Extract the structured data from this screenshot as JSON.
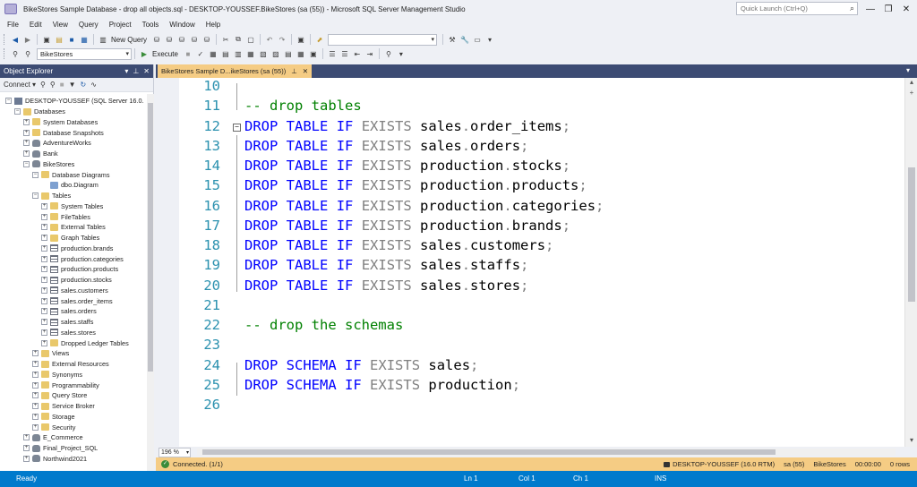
{
  "window": {
    "title": "BikeStores Sample Database - drop all objects.sql - DESKTOP-YOUSSEF.BikeStores (sa (55)) - Microsoft SQL Server Management Studio",
    "quick_launch_placeholder": "Quick Launch (Ctrl+Q)"
  },
  "menu": [
    "File",
    "Edit",
    "View",
    "Query",
    "Project",
    "Tools",
    "Window",
    "Help"
  ],
  "toolbar": {
    "new_query_label": "New Query",
    "database_selector": "BikeStores",
    "execute_label": "Execute"
  },
  "object_explorer": {
    "title": "Object Explorer",
    "connect_label": "Connect",
    "tree": [
      {
        "label": "DESKTOP-YOUSSEF (SQL Server 16.0.",
        "level": 0,
        "icon": "server-icon",
        "toggle": "-"
      },
      {
        "label": "Databases",
        "level": 1,
        "icon": "folder-icon",
        "toggle": "-"
      },
      {
        "label": "System Databases",
        "level": 2,
        "icon": "folder-icon",
        "toggle": "+"
      },
      {
        "label": "Database Snapshots",
        "level": 2,
        "icon": "folder-icon",
        "toggle": "+"
      },
      {
        "label": "AdventureWorks",
        "level": 2,
        "icon": "database-icon",
        "toggle": "+"
      },
      {
        "label": "Bank",
        "level": 2,
        "icon": "database-icon",
        "toggle": "+"
      },
      {
        "label": "BikeStores",
        "level": 2,
        "icon": "database-icon",
        "toggle": "-"
      },
      {
        "label": "Database Diagrams",
        "level": 3,
        "icon": "folder-icon",
        "toggle": "-"
      },
      {
        "label": "dbo.Diagram",
        "level": 4,
        "icon": "diagram-icon",
        "toggle": ""
      },
      {
        "label": "Tables",
        "level": 3,
        "icon": "folder-icon",
        "toggle": "-"
      },
      {
        "label": "System Tables",
        "level": 4,
        "icon": "folder-icon",
        "toggle": "+"
      },
      {
        "label": "FileTables",
        "level": 4,
        "icon": "folder-icon",
        "toggle": "+"
      },
      {
        "label": "External Tables",
        "level": 4,
        "icon": "folder-icon",
        "toggle": "+"
      },
      {
        "label": "Graph Tables",
        "level": 4,
        "icon": "folder-icon",
        "toggle": "+"
      },
      {
        "label": "production.brands",
        "level": 4,
        "icon": "table-icon",
        "toggle": "+"
      },
      {
        "label": "production.categories",
        "level": 4,
        "icon": "table-icon",
        "toggle": "+"
      },
      {
        "label": "production.products",
        "level": 4,
        "icon": "table-icon",
        "toggle": "+"
      },
      {
        "label": "production.stocks",
        "level": 4,
        "icon": "table-icon",
        "toggle": "+"
      },
      {
        "label": "sales.customers",
        "level": 4,
        "icon": "table-icon",
        "toggle": "+"
      },
      {
        "label": "sales.order_items",
        "level": 4,
        "icon": "table-icon",
        "toggle": "+"
      },
      {
        "label": "sales.orders",
        "level": 4,
        "icon": "table-icon",
        "toggle": "+"
      },
      {
        "label": "sales.staffs",
        "level": 4,
        "icon": "table-icon",
        "toggle": "+"
      },
      {
        "label": "sales.stores",
        "level": 4,
        "icon": "table-icon",
        "toggle": "+"
      },
      {
        "label": "Dropped Ledger Tables",
        "level": 4,
        "icon": "folder-icon",
        "toggle": "+"
      },
      {
        "label": "Views",
        "level": 3,
        "icon": "folder-icon",
        "toggle": "+"
      },
      {
        "label": "External Resources",
        "level": 3,
        "icon": "folder-icon",
        "toggle": "+"
      },
      {
        "label": "Synonyms",
        "level": 3,
        "icon": "folder-icon",
        "toggle": "+"
      },
      {
        "label": "Programmability",
        "level": 3,
        "icon": "folder-icon",
        "toggle": "+"
      },
      {
        "label": "Query Store",
        "level": 3,
        "icon": "folder-icon",
        "toggle": "+"
      },
      {
        "label": "Service Broker",
        "level": 3,
        "icon": "folder-icon",
        "toggle": "+"
      },
      {
        "label": "Storage",
        "level": 3,
        "icon": "folder-icon",
        "toggle": "+"
      },
      {
        "label": "Security",
        "level": 3,
        "icon": "folder-icon",
        "toggle": "+"
      },
      {
        "label": "E_Commerce",
        "level": 2,
        "icon": "database-icon",
        "toggle": "+"
      },
      {
        "label": "Final_Project_SQL",
        "level": 2,
        "icon": "database-icon",
        "toggle": "+"
      },
      {
        "label": "Northwind2021",
        "level": 2,
        "icon": "database-icon",
        "toggle": "+"
      }
    ]
  },
  "editor": {
    "tab_title": "BikeStores Sample D...ikeStores (sa (55))",
    "lines": [
      {
        "no": "10",
        "tokens": []
      },
      {
        "no": "11",
        "tokens": [
          {
            "t": "-- drop tables",
            "c": "cm"
          }
        ]
      },
      {
        "no": "12",
        "fold": "-",
        "tokens": [
          {
            "t": "DROP",
            "c": "kw"
          },
          {
            "t": " "
          },
          {
            "t": "TABLE",
            "c": "kw"
          },
          {
            "t": " "
          },
          {
            "t": "IF",
            "c": "kw"
          },
          {
            "t": " "
          },
          {
            "t": "EXISTS",
            "c": "gray"
          },
          {
            "t": " sales"
          },
          {
            "t": ".",
            "c": "gray"
          },
          {
            "t": "order_items"
          },
          {
            "t": ";",
            "c": "gray"
          }
        ]
      },
      {
        "no": "13",
        "tokens": [
          {
            "t": "DROP",
            "c": "kw"
          },
          {
            "t": " "
          },
          {
            "t": "TABLE",
            "c": "kw"
          },
          {
            "t": " "
          },
          {
            "t": "IF",
            "c": "kw"
          },
          {
            "t": " "
          },
          {
            "t": "EXISTS",
            "c": "gray"
          },
          {
            "t": " sales"
          },
          {
            "t": ".",
            "c": "gray"
          },
          {
            "t": "orders"
          },
          {
            "t": ";",
            "c": "gray"
          }
        ]
      },
      {
        "no": "14",
        "tokens": [
          {
            "t": "DROP",
            "c": "kw"
          },
          {
            "t": " "
          },
          {
            "t": "TABLE",
            "c": "kw"
          },
          {
            "t": " "
          },
          {
            "t": "IF",
            "c": "kw"
          },
          {
            "t": " "
          },
          {
            "t": "EXISTS",
            "c": "gray"
          },
          {
            "t": " production"
          },
          {
            "t": ".",
            "c": "gray"
          },
          {
            "t": "stocks"
          },
          {
            "t": ";",
            "c": "gray"
          }
        ]
      },
      {
        "no": "15",
        "tokens": [
          {
            "t": "DROP",
            "c": "kw"
          },
          {
            "t": " "
          },
          {
            "t": "TABLE",
            "c": "kw"
          },
          {
            "t": " "
          },
          {
            "t": "IF",
            "c": "kw"
          },
          {
            "t": " "
          },
          {
            "t": "EXISTS",
            "c": "gray"
          },
          {
            "t": " production"
          },
          {
            "t": ".",
            "c": "gray"
          },
          {
            "t": "products"
          },
          {
            "t": ";",
            "c": "gray"
          }
        ]
      },
      {
        "no": "16",
        "tokens": [
          {
            "t": "DROP",
            "c": "kw"
          },
          {
            "t": " "
          },
          {
            "t": "TABLE",
            "c": "kw"
          },
          {
            "t": " "
          },
          {
            "t": "IF",
            "c": "kw"
          },
          {
            "t": " "
          },
          {
            "t": "EXISTS",
            "c": "gray"
          },
          {
            "t": " production"
          },
          {
            "t": ".",
            "c": "gray"
          },
          {
            "t": "categories"
          },
          {
            "t": ";",
            "c": "gray"
          }
        ]
      },
      {
        "no": "17",
        "tokens": [
          {
            "t": "DROP",
            "c": "kw"
          },
          {
            "t": " "
          },
          {
            "t": "TABLE",
            "c": "kw"
          },
          {
            "t": " "
          },
          {
            "t": "IF",
            "c": "kw"
          },
          {
            "t": " "
          },
          {
            "t": "EXISTS",
            "c": "gray"
          },
          {
            "t": " production"
          },
          {
            "t": ".",
            "c": "gray"
          },
          {
            "t": "brands"
          },
          {
            "t": ";",
            "c": "gray"
          }
        ]
      },
      {
        "no": "18",
        "tokens": [
          {
            "t": "DROP",
            "c": "kw"
          },
          {
            "t": " "
          },
          {
            "t": "TABLE",
            "c": "kw"
          },
          {
            "t": " "
          },
          {
            "t": "IF",
            "c": "kw"
          },
          {
            "t": " "
          },
          {
            "t": "EXISTS",
            "c": "gray"
          },
          {
            "t": " sales"
          },
          {
            "t": ".",
            "c": "gray"
          },
          {
            "t": "customers"
          },
          {
            "t": ";",
            "c": "gray"
          }
        ]
      },
      {
        "no": "19",
        "tokens": [
          {
            "t": "DROP",
            "c": "kw"
          },
          {
            "t": " "
          },
          {
            "t": "TABLE",
            "c": "kw"
          },
          {
            "t": " "
          },
          {
            "t": "IF",
            "c": "kw"
          },
          {
            "t": " "
          },
          {
            "t": "EXISTS",
            "c": "gray"
          },
          {
            "t": " sales"
          },
          {
            "t": ".",
            "c": "gray"
          },
          {
            "t": "staffs"
          },
          {
            "t": ";",
            "c": "gray"
          }
        ]
      },
      {
        "no": "20",
        "tokens": [
          {
            "t": "DROP",
            "c": "kw"
          },
          {
            "t": " "
          },
          {
            "t": "TABLE",
            "c": "kw"
          },
          {
            "t": " "
          },
          {
            "t": "IF",
            "c": "kw"
          },
          {
            "t": " "
          },
          {
            "t": "EXISTS",
            "c": "gray"
          },
          {
            "t": " sales"
          },
          {
            "t": ".",
            "c": "gray"
          },
          {
            "t": "stores"
          },
          {
            "t": ";",
            "c": "gray"
          }
        ]
      },
      {
        "no": "21",
        "tokens": []
      },
      {
        "no": "22",
        "tokens": [
          {
            "t": "-- drop the schemas",
            "c": "cm"
          }
        ]
      },
      {
        "no": "23",
        "tokens": []
      },
      {
        "no": "24",
        "tokens": [
          {
            "t": "DROP",
            "c": "kw"
          },
          {
            "t": " "
          },
          {
            "t": "SCHEMA",
            "c": "kw"
          },
          {
            "t": " "
          },
          {
            "t": "IF",
            "c": "kw"
          },
          {
            "t": " "
          },
          {
            "t": "EXISTS",
            "c": "gray"
          },
          {
            "t": " sales"
          },
          {
            "t": ";",
            "c": "gray"
          }
        ]
      },
      {
        "no": "25",
        "tokens": [
          {
            "t": "DROP",
            "c": "kw"
          },
          {
            "t": " "
          },
          {
            "t": "SCHEMA",
            "c": "kw"
          },
          {
            "t": " "
          },
          {
            "t": "IF",
            "c": "kw"
          },
          {
            "t": " "
          },
          {
            "t": "EXISTS",
            "c": "gray"
          },
          {
            "t": " production"
          },
          {
            "t": ";",
            "c": "gray"
          }
        ]
      },
      {
        "no": "26",
        "tokens": []
      }
    ],
    "zoom": "196 %"
  },
  "connection_bar": {
    "status": "Connected. (1/1)",
    "server": "DESKTOP-YOUSSEF (16.0 RTM)",
    "user": "sa (55)",
    "database": "BikeStores",
    "elapsed": "00:00:00",
    "rows": "0 rows"
  },
  "status_bar": {
    "ready": "Ready",
    "ln": "Ln 1",
    "col": "Col 1",
    "ch": "Ch 1",
    "mode": "INS"
  },
  "colors": {
    "keyword": "#0000ff",
    "operator": "#808080",
    "comment": "#008000",
    "line_number": "#2b91af",
    "status_bar": "#007acc",
    "tab_active": "#f5cc84",
    "panel_header": "#3c4b73"
  }
}
